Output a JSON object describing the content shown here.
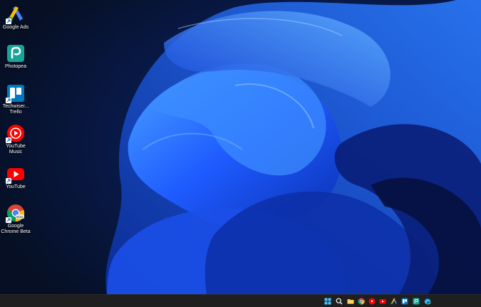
{
  "desktop_icons": [
    {
      "label": "Google Ads",
      "icon": "google-ads-icon",
      "shortcut": true
    },
    {
      "label": "Photopea",
      "icon": "photopea-icon",
      "shortcut": false
    },
    {
      "label": "Techwiser...\nTrello",
      "icon": "trello-icon",
      "shortcut": true
    },
    {
      "label": "YouTube\nMusic",
      "icon": "youtube-music-icon",
      "shortcut": true
    },
    {
      "label": "YouTube",
      "icon": "youtube-icon",
      "shortcut": true
    },
    {
      "label": "Google\nChrome Beta",
      "icon": "chrome-beta-icon",
      "shortcut": true
    }
  ],
  "chrome_badge": "Beta",
  "taskbar": {
    "apps": [
      "start-icon",
      "search-icon",
      "file-explorer-icon",
      "chrome-icon",
      "youtube-music-icon",
      "youtube-icon",
      "google-ads-icon",
      "trello-icon",
      "photopea-icon",
      "edge-icon"
    ]
  },
  "colors": {
    "wallpaper_base": "#0a1a3a",
    "wallpaper_bloom": "#1e5bff",
    "taskbar": "#1f1f1f",
    "youtube_red": "#ff0000",
    "trello_blue": "#0079bf",
    "photopea_teal": "#18a497"
  }
}
